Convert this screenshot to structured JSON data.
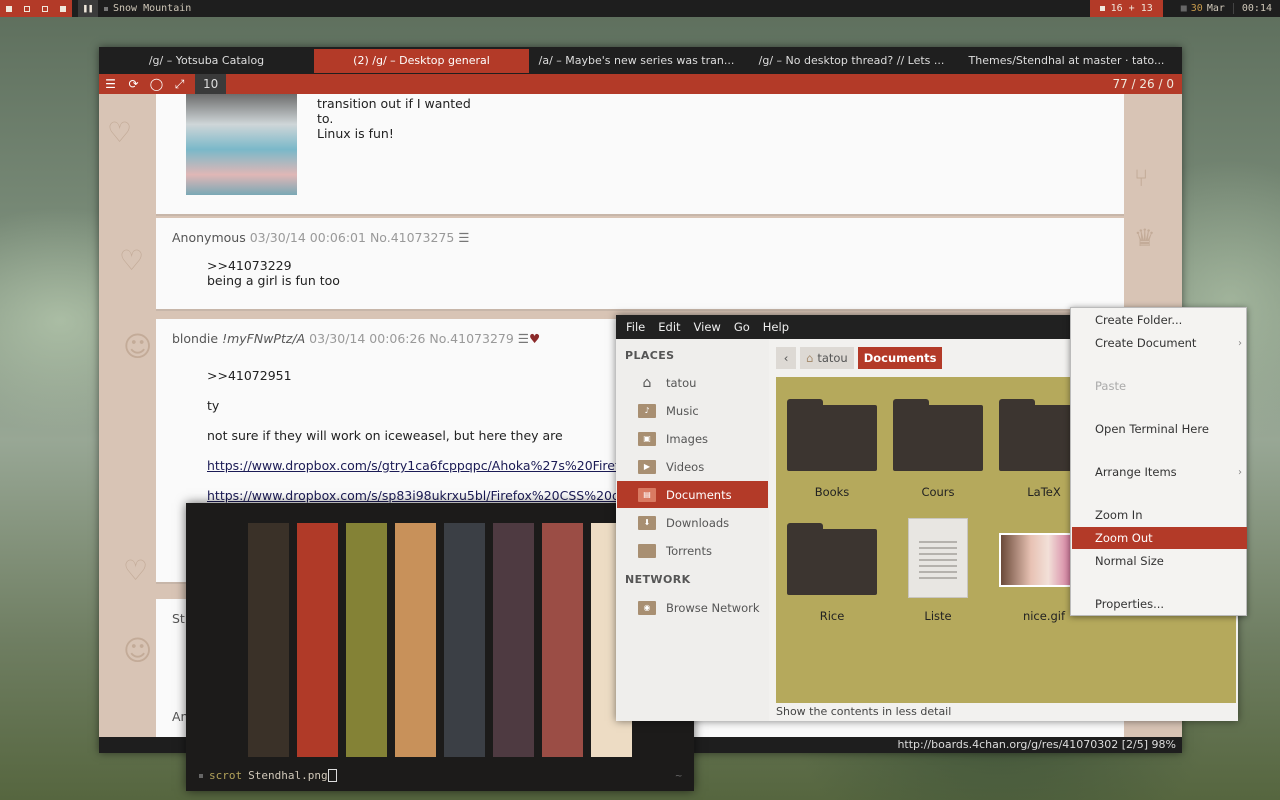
{
  "topbar": {
    "window_title": "Snow Mountain",
    "mail_count": "16 + 13",
    "date_day": "30",
    "date_month": "Mar",
    "time": "00:14"
  },
  "browser": {
    "tabs": [
      {
        "label": "/g/ – Yotsuba Catalog"
      },
      {
        "label": "(2) /g/ – Desktop general"
      },
      {
        "label": "/a/ – Maybe's new series was tran..."
      },
      {
        "label": "/g/ – No desktop thread? // Lets ..."
      },
      {
        "label": "Themes/Stendhal at master · tato..."
      }
    ],
    "tab_count": "10",
    "thread_stats": "77 / 26 / 0",
    "status_url": "http://boards.4chan.org/g/res/41070302 [2/5] 98%",
    "posts": [
      {
        "lines": [
          "transition out if I wanted",
          "to.",
          "Linux is fun!"
        ]
      },
      {
        "name": "Anonymous",
        "date": "03/30/14 00:06:01",
        "no": "No.41073275",
        "lines": [
          ">>41073229",
          "being a girl is fun too"
        ]
      },
      {
        "name": "blondie",
        "trip": "!myFNwPtz/A",
        "date": "03/30/14 00:06:26",
        "no": "No.41073279",
        "lines": [
          ">>41072951",
          "ty",
          "not sure if they will work on iceweasel, but here they are"
        ],
        "links": [
          "https://www.dropbox.com/s/gtry1ca6fcppqpc/Ahoka%27s%20Firefox",
          "https://www.dropbox.com/s/sp83i98ukrxu5bl/Firefox%20CSS%20dF.t"
        ]
      },
      {
        "name": "Str"
      },
      {
        "name": "An"
      }
    ]
  },
  "terminal": {
    "prompt_command": "scrot",
    "prompt_args": "Stendhal.png",
    "tilde": "~",
    "palette": [
      "#3a3128",
      "#b03a28",
      "#848236",
      "#c8915a",
      "#3b3f45",
      "#4e3a41",
      "#9b4d45",
      "#eddcc4"
    ]
  },
  "filemanager": {
    "menu": [
      "File",
      "Edit",
      "View",
      "Go",
      "Help"
    ],
    "places_header": "PLACES",
    "network_header": "NETWORK",
    "places": [
      {
        "label": "tatou",
        "icon": "home-icon"
      },
      {
        "label": "Music",
        "icon": "music-folder-icon"
      },
      {
        "label": "Images",
        "icon": "images-folder-icon"
      },
      {
        "label": "Videos",
        "icon": "videos-folder-icon"
      },
      {
        "label": "Documents",
        "icon": "documents-folder-icon"
      },
      {
        "label": "Downloads",
        "icon": "downloads-folder-icon"
      },
      {
        "label": "Torrents",
        "icon": "folder-icon"
      }
    ],
    "network": [
      {
        "label": "Browse Network",
        "icon": "network-icon"
      }
    ],
    "breadcrumb": {
      "home": "tatou",
      "current": "Documents"
    },
    "files": [
      "Books",
      "Cours",
      "LaTeX",
      "Rice",
      "Liste",
      "nice.gif"
    ],
    "status": "Show the contents in less detail"
  },
  "context_menu": {
    "items": [
      {
        "label": "Create Folder..."
      },
      {
        "label": "Create Document"
      },
      {
        "label": "Paste"
      },
      {
        "label": "Open Terminal Here"
      },
      {
        "label": "Arrange Items"
      },
      {
        "label": "Zoom In"
      },
      {
        "label": "Zoom Out"
      },
      {
        "label": "Normal Size"
      },
      {
        "label": "Properties..."
      }
    ]
  },
  "colors": {
    "accent": "#b33a28",
    "bar": "#1e1e1e",
    "file_area": "#b5a95c",
    "page_bg": "#d8c4b5"
  }
}
